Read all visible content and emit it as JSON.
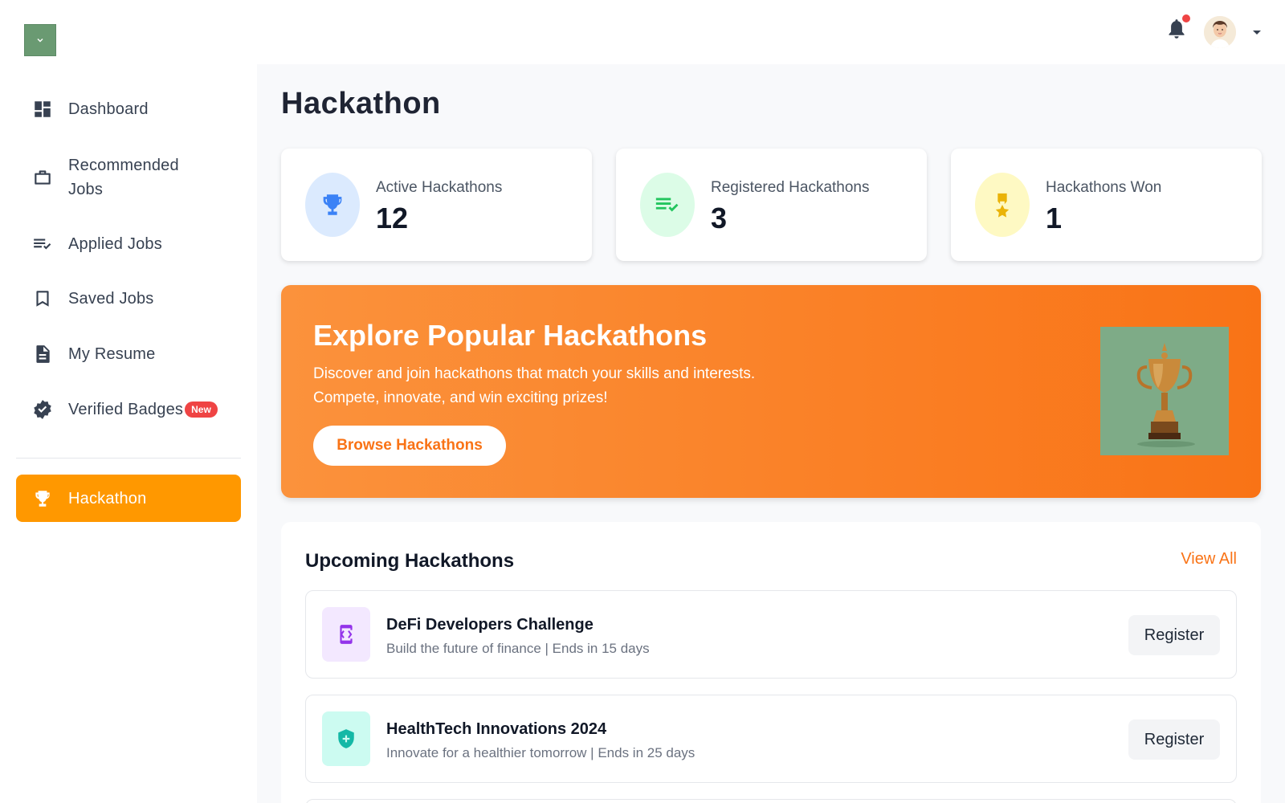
{
  "header": {
    "logo_icon": "chevron-down-icon",
    "notification_icon": "bell-icon",
    "has_unread_notifications": true,
    "avatar_icon": "user-avatar",
    "menu_icon": "caret-down-icon"
  },
  "sidebar": {
    "items": [
      {
        "label": "Dashboard",
        "icon": "dashboard-icon"
      },
      {
        "label": "Recommended Jobs",
        "icon": "briefcase-icon"
      },
      {
        "label": "Applied Jobs",
        "icon": "checklist-icon"
      },
      {
        "label": "Saved Jobs",
        "icon": "bookmark-icon"
      },
      {
        "label": "My Resume",
        "icon": "document-icon"
      },
      {
        "label": "Verified Badges",
        "icon": "verified-badge-icon",
        "badge": "New"
      },
      {
        "label": "Hackathon",
        "icon": "trophy-icon",
        "active": true
      }
    ]
  },
  "main": {
    "title": "Hackathon",
    "stats": [
      {
        "label": "Active Hackathons",
        "value": "12",
        "icon": "trophy-icon",
        "color": "#3b82f6",
        "bg": "#dbeafe"
      },
      {
        "label": "Registered Hackathons",
        "value": "3",
        "icon": "checklist-icon",
        "color": "#22c55e",
        "bg": "#dcfce7"
      },
      {
        "label": "Hackathons Won",
        "value": "1",
        "icon": "medal-icon",
        "color": "#eab308",
        "bg": "#fef9c3"
      }
    ],
    "banner": {
      "title": "Explore Popular Hackathons",
      "description_line1": "Discover and join hackathons that match your skills and interests.",
      "description_line2": "Compete, innovate, and win exciting prizes!",
      "button_label": "Browse Hackathons",
      "image": "golden-trophy-image"
    },
    "upcoming": {
      "title": "Upcoming Hackathons",
      "view_all_label": "View All",
      "items": [
        {
          "name": "DeFi Developers Challenge",
          "description": "Build the future of finance | Ends in 15 days",
          "button_label": "Register",
          "icon": "code-device-icon",
          "color": "#9333ea",
          "bg": "#f3e8ff"
        },
        {
          "name": "HealthTech Innovations 2024",
          "description": "Innovate for a healthier tomorrow | Ends in 25 days",
          "button_label": "Register",
          "icon": "health-shield-icon",
          "color": "#14b8a6",
          "bg": "#ccfbf1"
        }
      ]
    }
  },
  "colors": {
    "accent_orange": "#f97316",
    "sidebar_active": "#ff9800",
    "badge_red": "#ef4444"
  }
}
